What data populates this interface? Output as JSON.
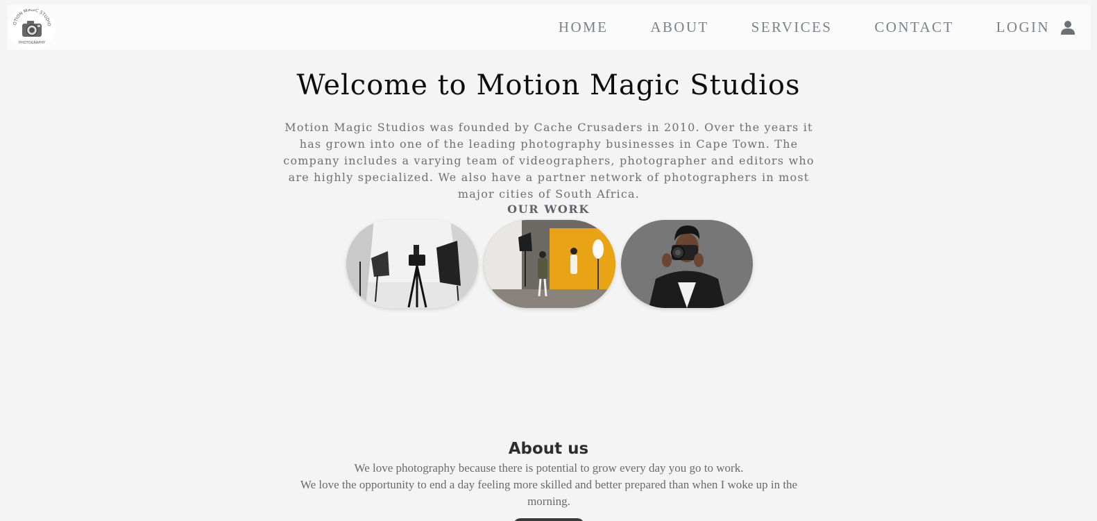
{
  "nav": {
    "logo_text": "MOTION MAGIC STUDIOS PHOTOGRAPHY",
    "items": [
      {
        "label": "HOME"
      },
      {
        "label": "ABOUT"
      },
      {
        "label": "SERVICES"
      },
      {
        "label": "CONTACT"
      }
    ],
    "login_label": "LOGIN",
    "login_icon": "user-icon"
  },
  "hero": {
    "title": "Welcome to Motion Magic Studios",
    "description": "Motion Magic Studios was founded by Cache Crusaders in 2010. Over the years it has grown into one of the leading photography businesses in Cape Town. The company includes a varying team of videographers, photographer and editors who are highly specialized. We also have a partner network of photographers in most major cities of South Africa."
  },
  "work": {
    "heading": "OUR WORK",
    "photos": [
      "studio-camera-tripod-photo",
      "studio-orange-backdrop-photo",
      "photographer-portrait-photo"
    ]
  },
  "about": {
    "title": "About us",
    "line1": "We love photography because there is potential to grow every day you go to work.",
    "line2": "We love the opportunity to end a day feeling more skilled and better prepared than when I woke up in the morning."
  },
  "colors": {
    "page_bg": "#f4f4f4",
    "nav_bg": "#fbfbfb",
    "nav_text": "#7d8188",
    "heading_text": "#0d0d0d",
    "body_text": "#6f6f6f",
    "accent_orange": "#e9a415"
  }
}
